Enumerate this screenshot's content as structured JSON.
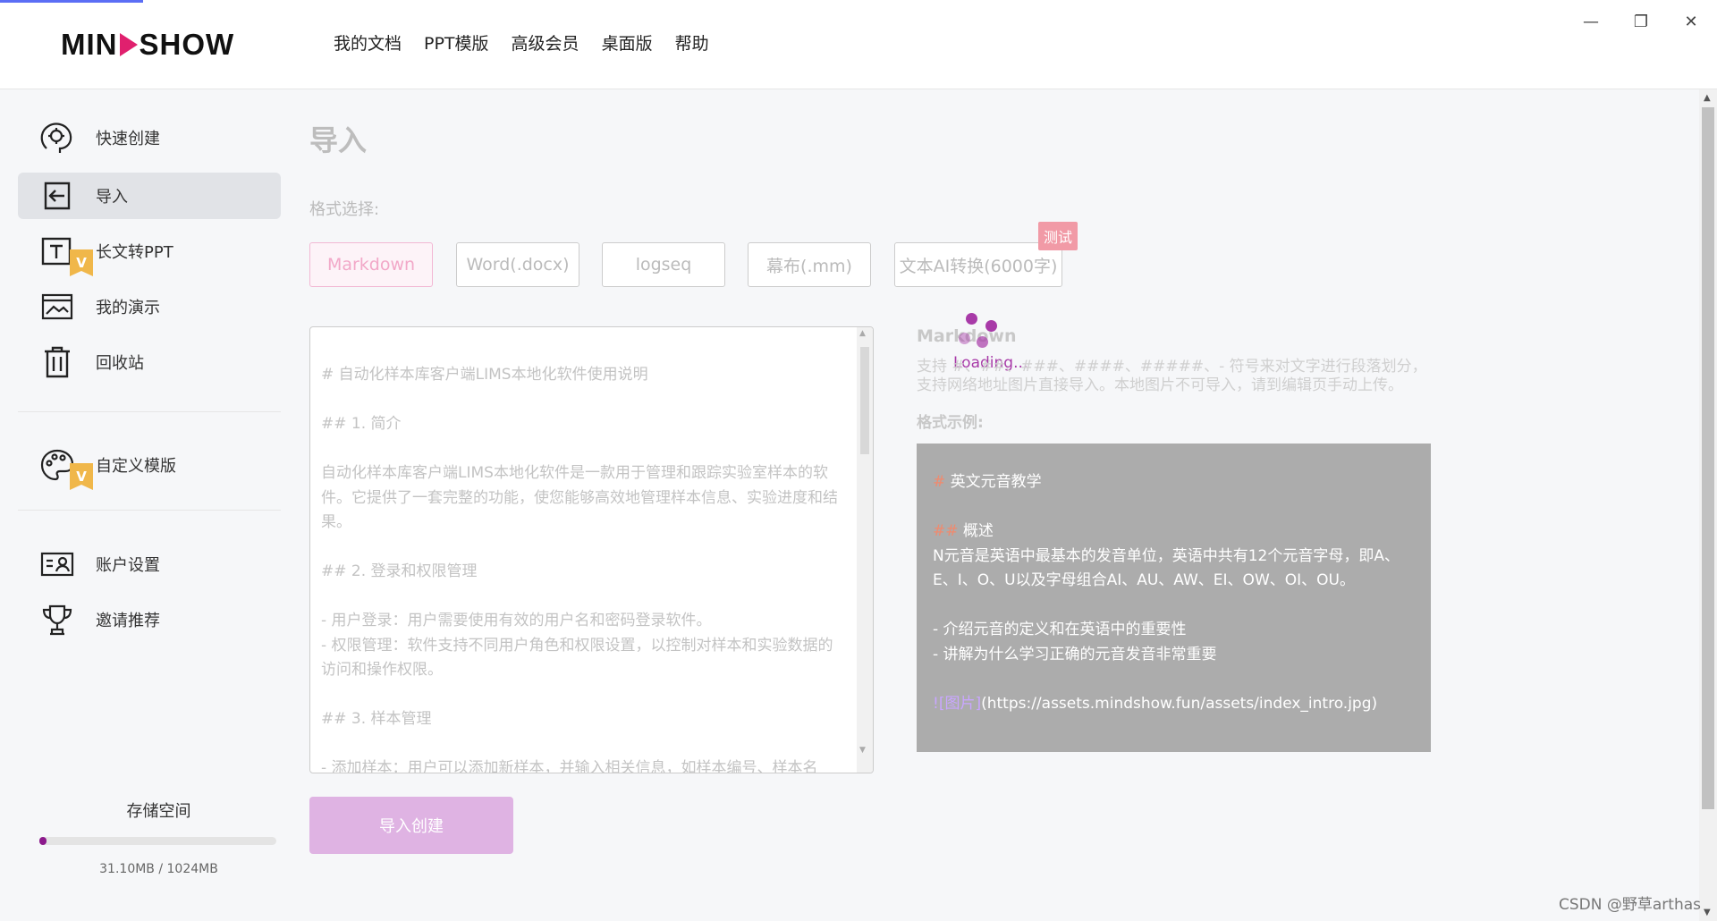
{
  "app": {
    "logo_left": "MIN",
    "logo_right": "SHOW",
    "nav": [
      "我的文档",
      "PPT模版",
      "高级会员",
      "桌面版",
      "帮助"
    ],
    "window_controls": [
      "minimize-icon",
      "restore-icon",
      "close-icon"
    ]
  },
  "sidebar": {
    "items": [
      {
        "label": "快速创建",
        "icon": "brain-icon"
      },
      {
        "label": "导入",
        "icon": "import-icon"
      },
      {
        "label": "长文转PPT",
        "icon": "text-icon",
        "badge": "V"
      },
      {
        "label": "我的演示",
        "icon": "slides-icon"
      },
      {
        "label": "回收站",
        "icon": "trash-icon"
      },
      {
        "label": "自定义模版",
        "icon": "palette-icon",
        "badge": "V"
      },
      {
        "label": "账户设置",
        "icon": "account-icon"
      },
      {
        "label": "邀请推荐",
        "icon": "trophy-icon"
      }
    ],
    "storage": {
      "title": "存储空间",
      "usage": "31.10MB / 1024MB",
      "percent": 3
    }
  },
  "main": {
    "title": "导入",
    "format_label": "格式选择:",
    "formats": [
      "Markdown",
      "Word(.docx)",
      "logseq",
      "幕布(.mm)",
      "文本AI转换(6000字)"
    ],
    "test_badge": "测试",
    "editor_text": "# 自动化样本库客户端LIMS本地化软件使用说明\n\n## 1. 简介\n\n自动化样本库客户端LIMS本地化软件是一款用于管理和跟踪实验室样本的软件。它提供了一套完整的功能，使您能够高效地管理样本信息、实验进度和结果。\n\n## 2. 登录和权限管理\n\n- 用户登录：用户需要使用有效的用户名和密码登录软件。\n- 权限管理：软件支持不同用户角色和权限设置，以控制对样本和实验数据的访问和操作权限。\n\n## 3. 样本管理\n\n- 添加样本：用户可以添加新样本，并输入相关信息，如样本编号、样本名",
    "import_button": "导入创建",
    "help": {
      "title": "Markdown",
      "desc": "支持 #、##、###、####、#####、- 符号来对文字进行段落划分，支持网络地址图片直接导入。本地图片不可导入，请到编辑页手动上传。",
      "example_label": "格式示例:",
      "example": {
        "h1": "英文元音教学",
        "h2": "概述",
        "para": " N元音是英语中最基本的发音单位，英语中共有12个元音字母，即A、E、I、O、U以及字母组合AI、AU、AW、EI、OW、OI、OU。",
        "li1": "- 介绍元音的定义和在英语中的重要性",
        "li2": "- 讲解为什么学习正确的元音发音非常重要",
        "img_label": "[图片]",
        "img_url": "(https://assets.mindshow.fun/assets/index_intro.jpg)"
      }
    },
    "loading": "Loading..."
  },
  "watermark": "CSDN @野草arthas",
  "colors": {
    "brand": "#e0206e",
    "purple": "#a83aa8",
    "button": "#dfb3e3"
  }
}
